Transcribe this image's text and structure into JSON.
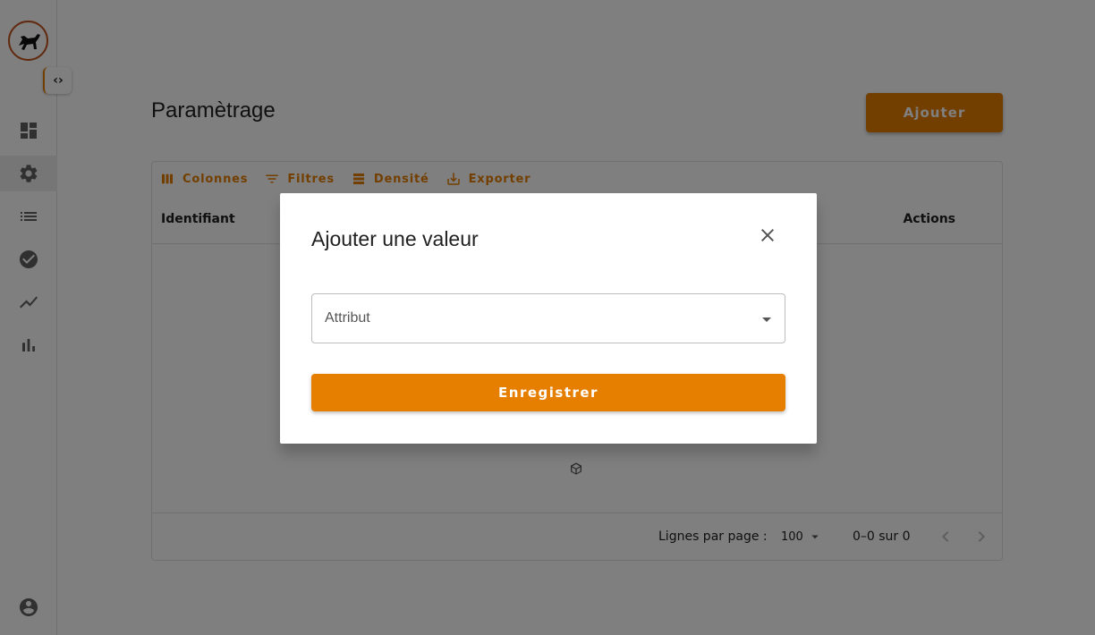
{
  "sidebar": {
    "logo_icon": "horse-logo",
    "toggle_label": "‹›",
    "items": [
      {
        "icon": "dashboard-icon"
      },
      {
        "icon": "settings-icon",
        "active": true
      },
      {
        "icon": "list-icon"
      },
      {
        "icon": "check-circle-icon"
      },
      {
        "icon": "trending-icon"
      },
      {
        "icon": "bar-chart-icon"
      }
    ],
    "account_icon": "account-circle-icon"
  },
  "page": {
    "title": "Paramètrage",
    "add_button": "Ajouter"
  },
  "grid": {
    "toolbar": {
      "columns": "Colonnes",
      "filters": "Filtres",
      "density": "Densité",
      "export": "Exporter"
    },
    "columns": {
      "id": "Identifiant",
      "actions": "Actions"
    },
    "footer": {
      "rows_per_page_label": "Lignes par page :",
      "rows_per_page_value": "100",
      "range": "0–0 sur 0"
    }
  },
  "dialog": {
    "title": "Ajouter une valeur",
    "select_label": "Attribut",
    "save_button": "Enregistrer"
  },
  "colors": {
    "accent": "#e67e00",
    "logo_border": "#c2551f"
  }
}
